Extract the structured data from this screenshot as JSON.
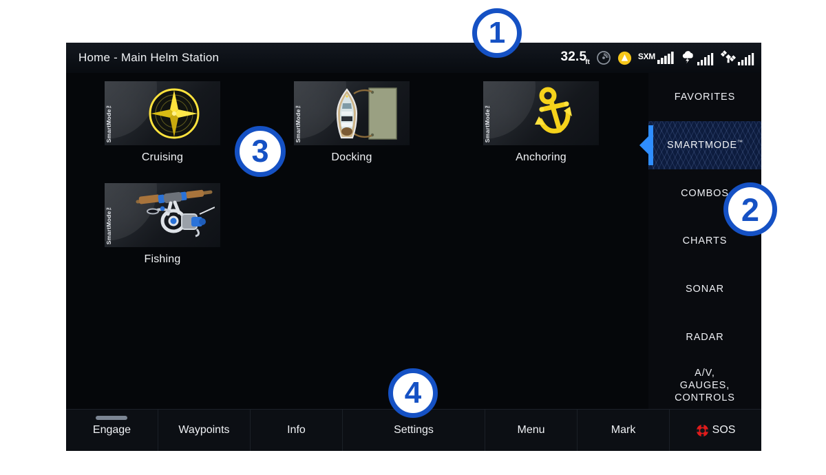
{
  "header": {
    "title": "Home - Main Helm Station",
    "status": {
      "depth_value": "32.5",
      "depth_unit": "ft",
      "sonar_icon": "sonar-depth-icon",
      "alert_icon": "yellow-alert-triangle-icon",
      "sxm_label": "SXM",
      "sxm_icon": "sxm-signal-icon",
      "weather_icon": "weather-storm-signal-icon",
      "satellite_icon": "satellite-signal-icon"
    }
  },
  "tiles": [
    {
      "label": "Cruising",
      "badge": "SmartMode™",
      "icon": "compass-rose-icon"
    },
    {
      "label": "Docking",
      "badge": "SmartMode™",
      "icon": "boat-at-dock-icon"
    },
    {
      "label": "Anchoring",
      "badge": "SmartMode™",
      "icon": "anchor-icon"
    },
    {
      "label": "Fishing",
      "badge": "SmartMode™",
      "icon": "fishing-rod-reel-icon"
    }
  ],
  "sidebar": {
    "items": [
      {
        "label": "FAVORITES",
        "selected": false
      },
      {
        "label": "SMARTMODE",
        "trademark": "™",
        "selected": true
      },
      {
        "label": "COMBOS",
        "selected": false
      },
      {
        "label": "CHARTS",
        "selected": false
      },
      {
        "label": "SONAR",
        "selected": false
      },
      {
        "label": "RADAR",
        "selected": false
      },
      {
        "label": "A/V,\nGAUGES,\nCONTROLS",
        "selected": false
      }
    ]
  },
  "toolbar": {
    "buttons": [
      {
        "label": "Engage",
        "indicator": true
      },
      {
        "label": "Waypoints",
        "indicator": false
      },
      {
        "label": "Info",
        "indicator": false
      },
      {
        "label": "Settings",
        "indicator": false
      },
      {
        "label": "Menu",
        "indicator": false
      },
      {
        "label": "Mark",
        "indicator": false
      },
      {
        "label": "SOS",
        "indicator": false,
        "icon": "life-ring-sos-icon"
      }
    ]
  },
  "callouts": [
    {
      "number": "1"
    },
    {
      "number": "2"
    },
    {
      "number": "3"
    },
    {
      "number": "4"
    }
  ],
  "colors": {
    "accent_blue": "#1551c4",
    "selection_blue": "#2f8eff",
    "selection_fill": "#0d1c3e",
    "gold": "#ffd21e",
    "sos_red": "#e01b1b",
    "screen_bg": "#0a0c10"
  }
}
